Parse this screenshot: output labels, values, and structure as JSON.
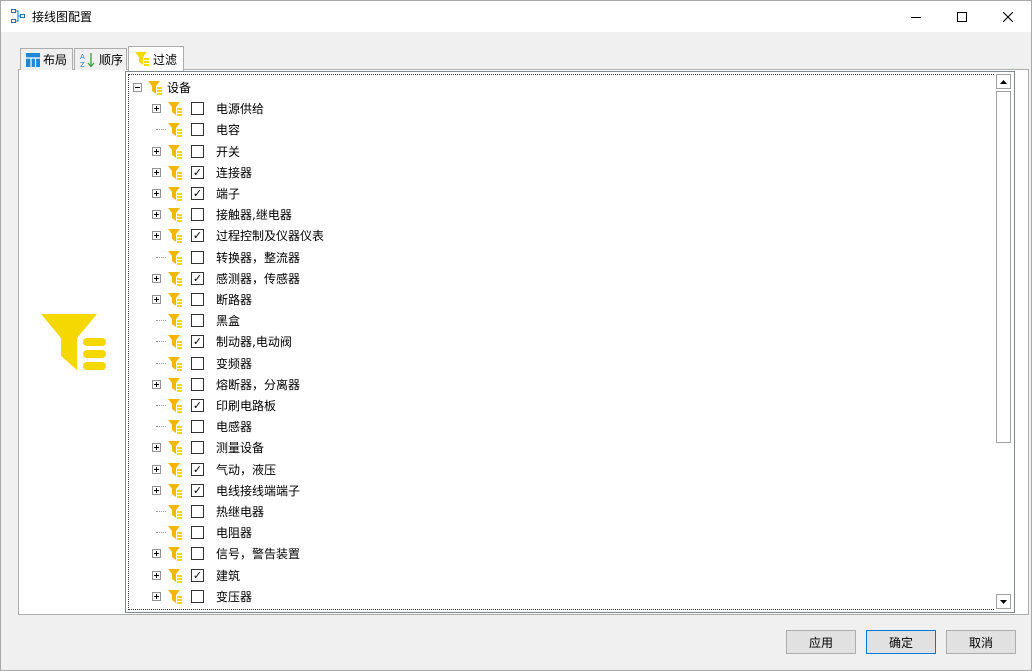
{
  "window": {
    "title": "接线图配置"
  },
  "tabs": [
    {
      "label": "布局",
      "icon": "layout-grid-icon"
    },
    {
      "label": "顺序",
      "icon": "sort-az-icon"
    },
    {
      "label": "过滤",
      "icon": "filter-icon",
      "active": true
    }
  ],
  "tree": {
    "root": {
      "label": "设备",
      "expanded": true
    },
    "items": [
      {
        "label": "电源供给",
        "expandable": true,
        "checked": false
      },
      {
        "label": "电容",
        "expandable": false,
        "checked": false
      },
      {
        "label": "开关",
        "expandable": true,
        "checked": false
      },
      {
        "label": "连接器",
        "expandable": true,
        "checked": true
      },
      {
        "label": "端子",
        "expandable": true,
        "checked": true
      },
      {
        "label": "接触器,继电器",
        "expandable": true,
        "checked": false
      },
      {
        "label": "过程控制及仪器仪表",
        "expandable": true,
        "checked": true
      },
      {
        "label": "转换器，整流器",
        "expandable": false,
        "checked": false
      },
      {
        "label": "感测器，传感器",
        "expandable": true,
        "checked": true
      },
      {
        "label": "断路器",
        "expandable": true,
        "checked": false
      },
      {
        "label": "黑盒",
        "expandable": false,
        "checked": false
      },
      {
        "label": "制动器,电动阀",
        "expandable": false,
        "checked": true
      },
      {
        "label": "变频器",
        "expandable": false,
        "checked": false
      },
      {
        "label": "熔断器，分离器",
        "expandable": true,
        "checked": false
      },
      {
        "label": "印刷电路板",
        "expandable": false,
        "checked": true
      },
      {
        "label": "电感器",
        "expandable": false,
        "checked": false
      },
      {
        "label": "测量设备",
        "expandable": true,
        "checked": false
      },
      {
        "label": "气动，液压",
        "expandable": true,
        "checked": true
      },
      {
        "label": "电线接线端端子",
        "expandable": true,
        "checked": true
      },
      {
        "label": "热继电器",
        "expandable": false,
        "checked": false
      },
      {
        "label": "电阻器",
        "expandable": false,
        "checked": false
      },
      {
        "label": "信号，警告装置",
        "expandable": true,
        "checked": false
      },
      {
        "label": "建筑",
        "expandable": true,
        "checked": true
      },
      {
        "label": "变压器",
        "expandable": true,
        "checked": false
      }
    ]
  },
  "buttons": {
    "apply": "应用",
    "ok": "确定",
    "cancel": "取消"
  },
  "colors": {
    "filter_yellow": "#f5d800",
    "accent": "#0078d7"
  }
}
